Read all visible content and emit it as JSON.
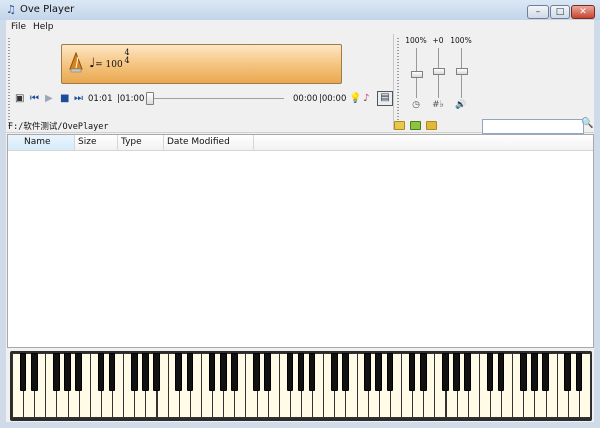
{
  "window": {
    "title": "Ove Player",
    "icon": "music-note-icon",
    "minimize": "–",
    "maximize": "□",
    "close": "✕"
  },
  "menu": {
    "items": [
      "File",
      "Help"
    ]
  },
  "display": {
    "tempo_prefix": "= 100",
    "time_sig_top": "4",
    "time_sig_bottom": "4",
    "bg_color": "#f4c27c"
  },
  "transport": {
    "bar_position": "01:01",
    "bar_total": "|01:00",
    "time_current": "00:00",
    "time_total": "|00:00",
    "progress": 0
  },
  "mixer": {
    "volume_label": "100%",
    "volume_level": 0.62,
    "transpose_label": "+0",
    "transpose_level": 0.5,
    "speed_label": "100%",
    "speed_level": 0.5
  },
  "browser": {
    "path": "F:/软件测试/OvePlayer",
    "search_value": "",
    "columns": [
      "Name",
      "Size",
      "Type",
      "Date Modified"
    ],
    "rows": []
  },
  "piano": {
    "octaves": 7,
    "extra_white_keys": 3,
    "white_key_color": "#fffbe6",
    "black_key_color": "#111111"
  }
}
